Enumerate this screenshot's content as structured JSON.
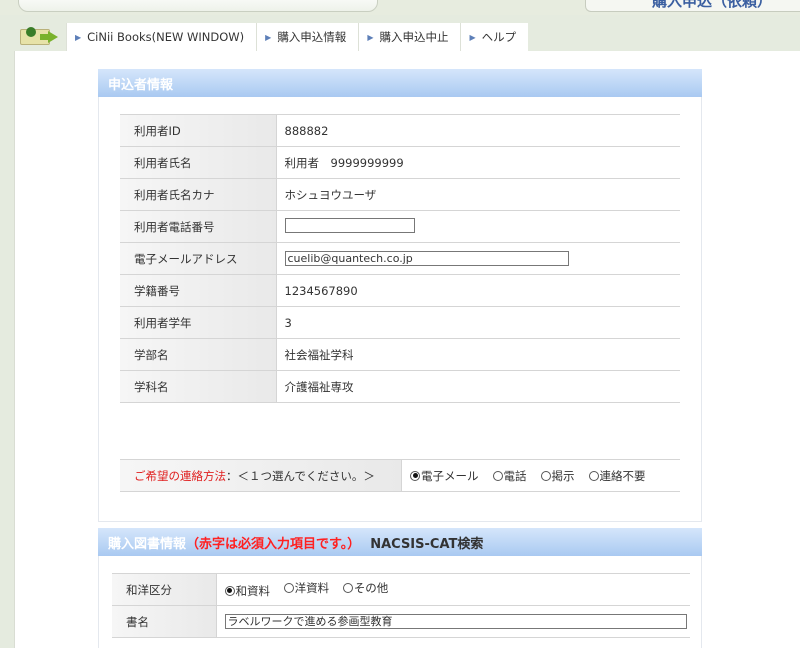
{
  "header": {
    "title": "購入申込（依頼）"
  },
  "nav": {
    "items": [
      {
        "label": "CiNii Books(NEW WINDOW)"
      },
      {
        "label": "購入申込情報"
      },
      {
        "label": "購入申込中止"
      },
      {
        "label": "ヘルプ"
      }
    ]
  },
  "applicant": {
    "section_title": "申込者情報",
    "fields": [
      {
        "label": "利用者ID",
        "value": "888882"
      },
      {
        "label": "利用者氏名",
        "value": "利用者　9999999999"
      },
      {
        "label": "利用者氏名カナ",
        "value": "ホシュヨウユーザ"
      },
      {
        "label": "利用者電話番号",
        "value": ""
      },
      {
        "label": "電子メールアドレス",
        "value": "cuelib@quantech.co.jp"
      },
      {
        "label": "学籍番号",
        "value": "1234567890"
      },
      {
        "label": "利用者学年",
        "value": "3"
      },
      {
        "label": "学部名",
        "value": "社会福祉学科"
      },
      {
        "label": "学科名",
        "value": "介護福祉専攻"
      }
    ],
    "contact": {
      "label_required": "ご希望の連絡方法",
      "label_note": "：＜１つ選んでください。＞",
      "options": [
        "電子メール",
        "電話",
        "掲示",
        "連絡不要"
      ],
      "selected": "電子メール"
    }
  },
  "book": {
    "section_title": "購入図書情報",
    "section_note": "（赤字は必須入力項目です。）",
    "search_link": "NACSIS-CAT検索",
    "fields": [
      {
        "label": "和洋区分",
        "options": [
          "和資料",
          "洋資料",
          "その他"
        ],
        "selected": "和資料"
      },
      {
        "label": "書名",
        "value": "ラベルワークで進める参画型教育"
      }
    ]
  }
}
